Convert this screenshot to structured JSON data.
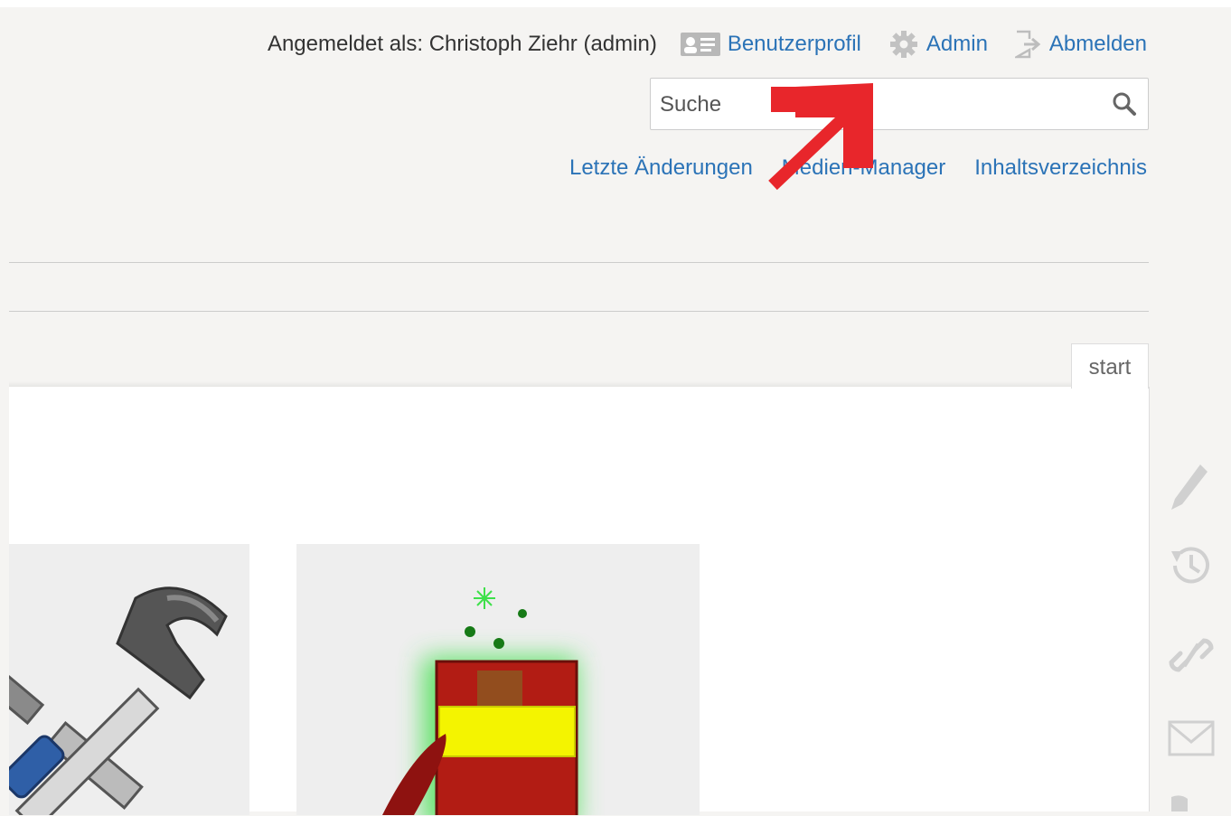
{
  "header": {
    "logged_in_text": "Angemeldet als: Christoph Ziehr (admin)",
    "profile_label": "Benutzerprofil",
    "admin_label": "Admin",
    "logout_label": "Abmelden"
  },
  "search": {
    "placeholder": "Suche"
  },
  "site_tools": {
    "recent_changes": "Letzte Änderungen",
    "media_manager": "Medien-Manager",
    "index": "Inhaltsverzeichnis"
  },
  "page_tab": {
    "label": "start"
  },
  "page_tools": [
    "pencil-icon",
    "history-icon",
    "link-icon",
    "mail-icon"
  ],
  "colors": {
    "link": "#2b73b7",
    "annotation_arrow": "#e8262b",
    "background": "#f5f4f2"
  }
}
